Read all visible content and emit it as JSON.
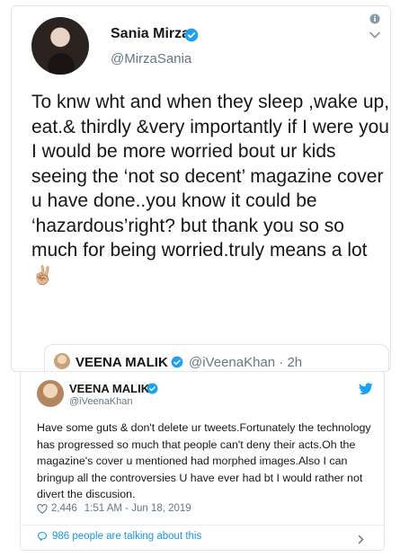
{
  "tweet1": {
    "name": "Sania Mirza",
    "handle": "@MirzaSania",
    "text": "To knw wht and when they sleep ,wake up, eat.& thirdly &very importantly if I were you I would be more worried bout ur kids seeing the ‘not so decent’ magazine cover u have done..you know it could be ‘hazardous’right? but thank you so so much for being worried.truly means a lot",
    "emoji": "✌🏼",
    "icons": {
      "info": "info-icon",
      "menu": "chevron-down-icon",
      "verified": "verified-badge-icon"
    }
  },
  "quote_header": {
    "name": "VEENA MALIK",
    "handle": "@iVeenaKhan · 2h"
  },
  "tweet2": {
    "name": "VEENA MALIK",
    "handle": "@iVeenaKhan",
    "text": "Have some guts & don't delete ur tweets.Fortunately the technology has progressed so much that people can't deny their acts.Oh the magazine's cover u mentioned had morphed images.Also I can bringup all the controversies U have ever had bt I would rather not divert the discusion.",
    "likes": "2,446",
    "timestamp": "1:51 AM - Jun 18, 2019",
    "talking": "986 people are talking about this",
    "icons": {
      "brand": "twitter-bird-icon",
      "like": "heart-icon",
      "reply": "speech-bubble-icon"
    }
  },
  "colors": {
    "twitter_blue": "#1da1f2",
    "link_blue": "#1b95e0",
    "gray": "#657786",
    "text": "#14171a"
  }
}
